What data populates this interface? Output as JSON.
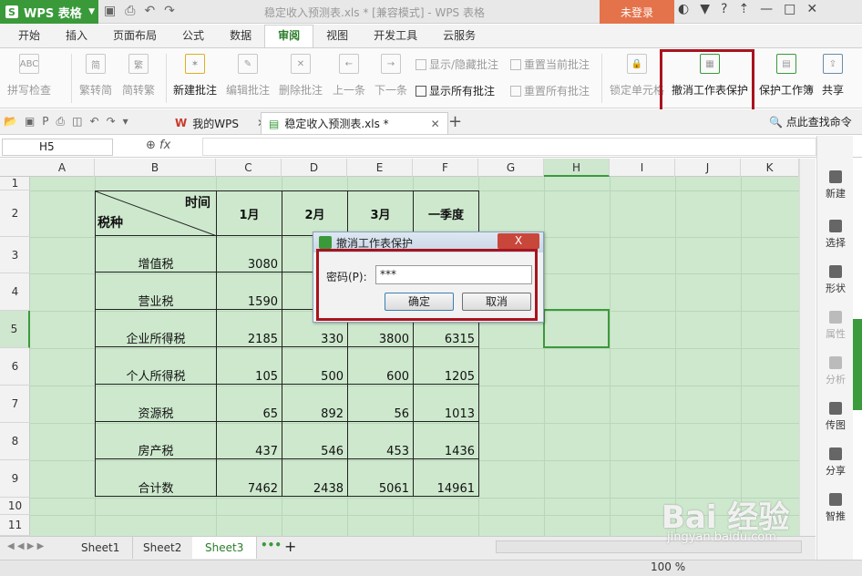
{
  "app": {
    "name": "WPS 表格",
    "window_title": "稳定收入预测表.xls * [兼容模式] - WPS 表格",
    "login": "未登录"
  },
  "ribbon_tabs": [
    "开始",
    "插入",
    "页面布局",
    "公式",
    "数据",
    "审阅",
    "视图",
    "开发工具",
    "云服务"
  ],
  "active_tab": "审阅",
  "ribbon": {
    "spell": "拼写检查",
    "trad_to_simp": "繁转简",
    "simp_to_trad": "简转繁",
    "new_comment": "新建批注",
    "edit_comment": "编辑批注",
    "delete_comment": "删除批注",
    "prev": "上一条",
    "next": "下一条",
    "show_hide_comment": "显示/隐藏批注",
    "reset_current_comment": "重置当前批注",
    "show_all_comments": "显示所有批注",
    "reset_all_comments": "重置所有批注",
    "lock_cell": "锁定单元格",
    "unprotect_sheet": "撤消工作表保护",
    "protect_workbook": "保护工作簿",
    "share": "共享"
  },
  "doc_tabs": [
    "我的WPS",
    "稳定收入预测表.xls *"
  ],
  "find_command": "点此查找命令",
  "name_box": "H5",
  "fx": "fx",
  "columns": [
    "A",
    "B",
    "C",
    "D",
    "E",
    "F",
    "G",
    "H",
    "I",
    "J",
    "K"
  ],
  "selected_column": "H",
  "rows": [
    "1",
    "2",
    "3",
    "4",
    "5",
    "6",
    "7",
    "8",
    "9",
    "10",
    "11"
  ],
  "selected_row": "5",
  "table": {
    "corner_top": "时间",
    "corner_bottom": "税种",
    "headers": [
      "1月",
      "2月",
      "3月",
      "一季度"
    ],
    "rows": [
      {
        "label": "增值税",
        "values": [
          "3080",
          "",
          "",
          ""
        ]
      },
      {
        "label": "营业税",
        "values": [
          "1590",
          "",
          "",
          ""
        ]
      },
      {
        "label": "企业所得税",
        "values": [
          "2185",
          "330",
          "3800",
          "6315"
        ]
      },
      {
        "label": "个人所得税",
        "values": [
          "105",
          "500",
          "600",
          "1205"
        ]
      },
      {
        "label": "资源税",
        "values": [
          "65",
          "892",
          "56",
          "1013"
        ]
      },
      {
        "label": "房产税",
        "values": [
          "437",
          "546",
          "453",
          "1436"
        ]
      },
      {
        "label": "合计数",
        "values": [
          "7462",
          "2438",
          "5061",
          "14961"
        ]
      }
    ]
  },
  "dialog": {
    "title": "撤消工作表保护",
    "close": "X",
    "password_label": "密码(P):",
    "password_value": "***",
    "ok": "确定",
    "cancel": "取消"
  },
  "sidebar": [
    "新建",
    "选择",
    "形状",
    "属性",
    "分析",
    "传图",
    "分享",
    "智推"
  ],
  "sheets": [
    "Sheet1",
    "Sheet2",
    "Sheet3"
  ],
  "active_sheet": "Sheet3",
  "zoom": "100 %",
  "watermark": {
    "main": "Bai 经验",
    "sub": "jingyan.baidu.com"
  },
  "colors": {
    "accent": "#3a9a3a",
    "highlight": "#a8141e",
    "grid_bg": "#cde8cd",
    "login": "#e4734b"
  }
}
